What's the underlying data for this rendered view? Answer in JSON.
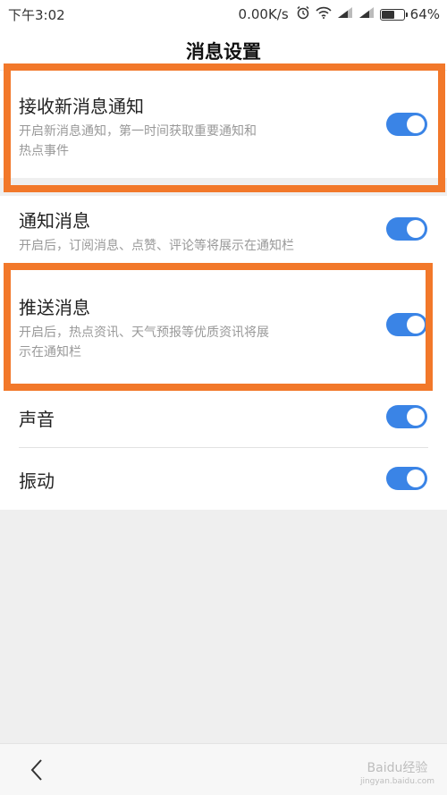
{
  "status_bar": {
    "time": "下午3:02",
    "speed": "0.00K/s",
    "battery": "64%",
    "battery_level": 0.64,
    "icons": [
      "alarm-icon",
      "wifi-icon",
      "signal-icon",
      "signal-icon",
      "battery-icon"
    ]
  },
  "header": {
    "title": "消息设置"
  },
  "settings": {
    "receive": {
      "title": "接收新消息通知",
      "desc": "开启新消息通知，第一时间获取重要通知和热点事件",
      "enabled": true
    },
    "notify": {
      "title": "通知消息",
      "desc": "开启后，订阅消息、点赞、评论等将展示在通知栏",
      "enabled": true
    },
    "push": {
      "title": "推送消息",
      "desc": "开启后，热点资讯、天气预报等优质资讯将展示在通知栏",
      "enabled": true
    },
    "sound": {
      "title": "声音",
      "enabled": true
    },
    "vibrate": {
      "title": "振动",
      "enabled": true
    }
  },
  "bottom_bar": {
    "back_icon": "chevron-left-icon",
    "watermark": "Baidu经验",
    "watermark_url": "jingyan.baidu.com"
  },
  "colors": {
    "toggle_on": "#3a84e6",
    "highlight": "#f2782a",
    "background": "#efefef"
  }
}
